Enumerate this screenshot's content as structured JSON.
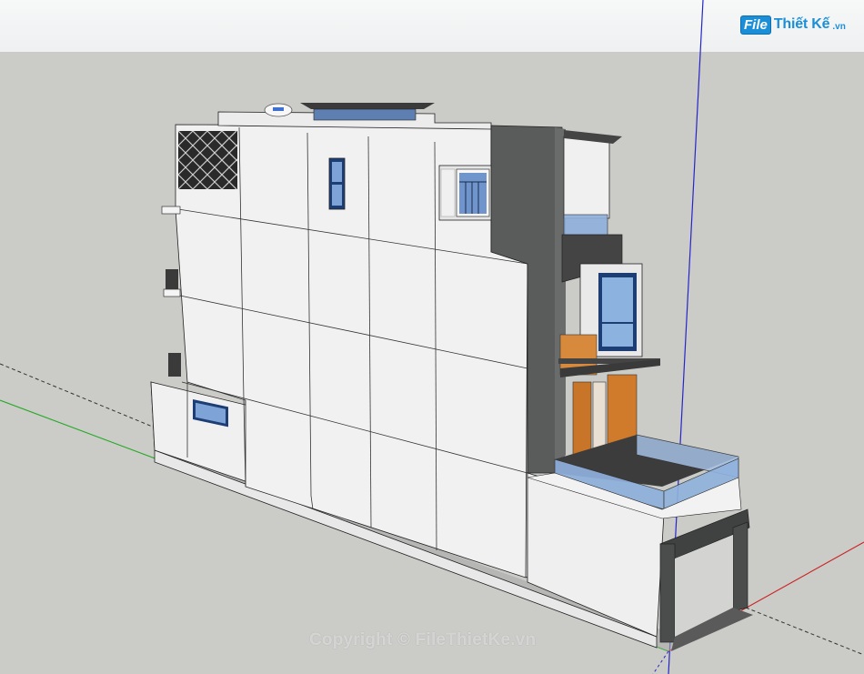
{
  "logo": {
    "mark": "File",
    "name": "Thiết Kế",
    "tld": ".vn"
  },
  "watermark": "Copyright © FileThietKe.vn",
  "colors": {
    "sky": "#f2f3f4",
    "ground": "#cbcbc8",
    "wall_light": "#eeeeee",
    "wall_shadow": "#e4e4e4",
    "accent_dark": "#5b5d5d",
    "glass": "#8fb0dc",
    "wood": "#d07a2c",
    "axis_blue": "#2626c8",
    "axis_red": "#cc2222",
    "axis_green": "#22aa22",
    "brand": "#1a8fd8"
  }
}
